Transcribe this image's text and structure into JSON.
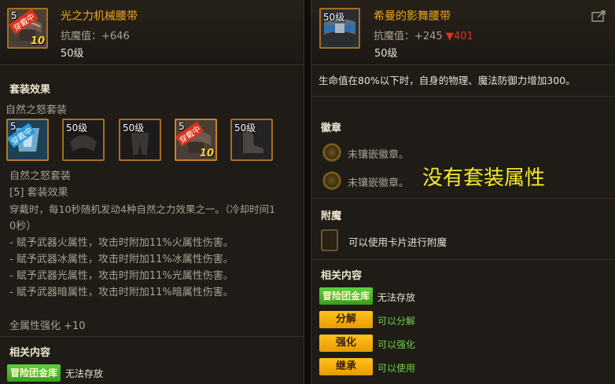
{
  "left": {
    "name": "光之力机械腰带",
    "stat_label": "抗魔值：",
    "stat_value": "+646",
    "level": "50级",
    "icon_level": "5",
    "equipped_badge": "穿戴中",
    "reinforce": "10",
    "set_section": "套装效果",
    "set_name": "自然之怒套装",
    "set_items": [
      {
        "level": "5",
        "badge": "穿戴中"
      },
      {
        "level": "50级"
      },
      {
        "level": "50级"
      },
      {
        "level": "5",
        "badge": "穿戴中",
        "reinforce": "10"
      },
      {
        "level": "50级"
      }
    ],
    "set_desc": [
      "自然之怒套装",
      "[5] 套装效果",
      "穿戴时，每10秒随机发动4种自然之力效果之一。（冷却时间1",
      "0秒）",
      "- 赋予武器火属性，攻击时附加11%火属性伤害。",
      "- 赋予武器冰属性，攻击时附加11%冰属性伤害。",
      "- 赋予武器光属性，攻击时附加11%光属性伤害。",
      "- 赋予武器暗属性，攻击时附加11%暗属性伤害。"
    ],
    "all_attr": "全属性强化 +10",
    "related_section": "相关内容",
    "vault_badge": "冒险团金库",
    "vault_status": "无法存放"
  },
  "right": {
    "name": "希曼的影舞腰带",
    "stat_label": "抗魔值：",
    "stat_value": "+245",
    "stat_diff": "▼401",
    "level": "50级",
    "icon_level": "50级",
    "effect": "生命值在80%以下时，自身的物理、魔法防御力增加300。",
    "emblem_section": "徽章",
    "emblems": [
      "未镶嵌徽章。",
      "未镶嵌徽章。"
    ],
    "no_set_note": "没有套装属性",
    "enchant_section": "附魔",
    "enchant_text": "可以使用卡片进行附魔",
    "related_section": "相关内容",
    "related": [
      {
        "badge": "冒险团金库",
        "status": "无法存放",
        "style": "green-badge"
      },
      {
        "badge": "分解",
        "status": "可以分解",
        "style": "gold-badge"
      },
      {
        "badge": "强化",
        "status": "可以强化",
        "style": "gold-badge"
      },
      {
        "badge": "继承",
        "status": "可以使用",
        "style": "gold-badge"
      }
    ]
  },
  "colors": {
    "item_name": "#f1a51c",
    "diff_down": "#e0311f",
    "positive": "#6fd24a",
    "note": "#f5ea2a"
  }
}
